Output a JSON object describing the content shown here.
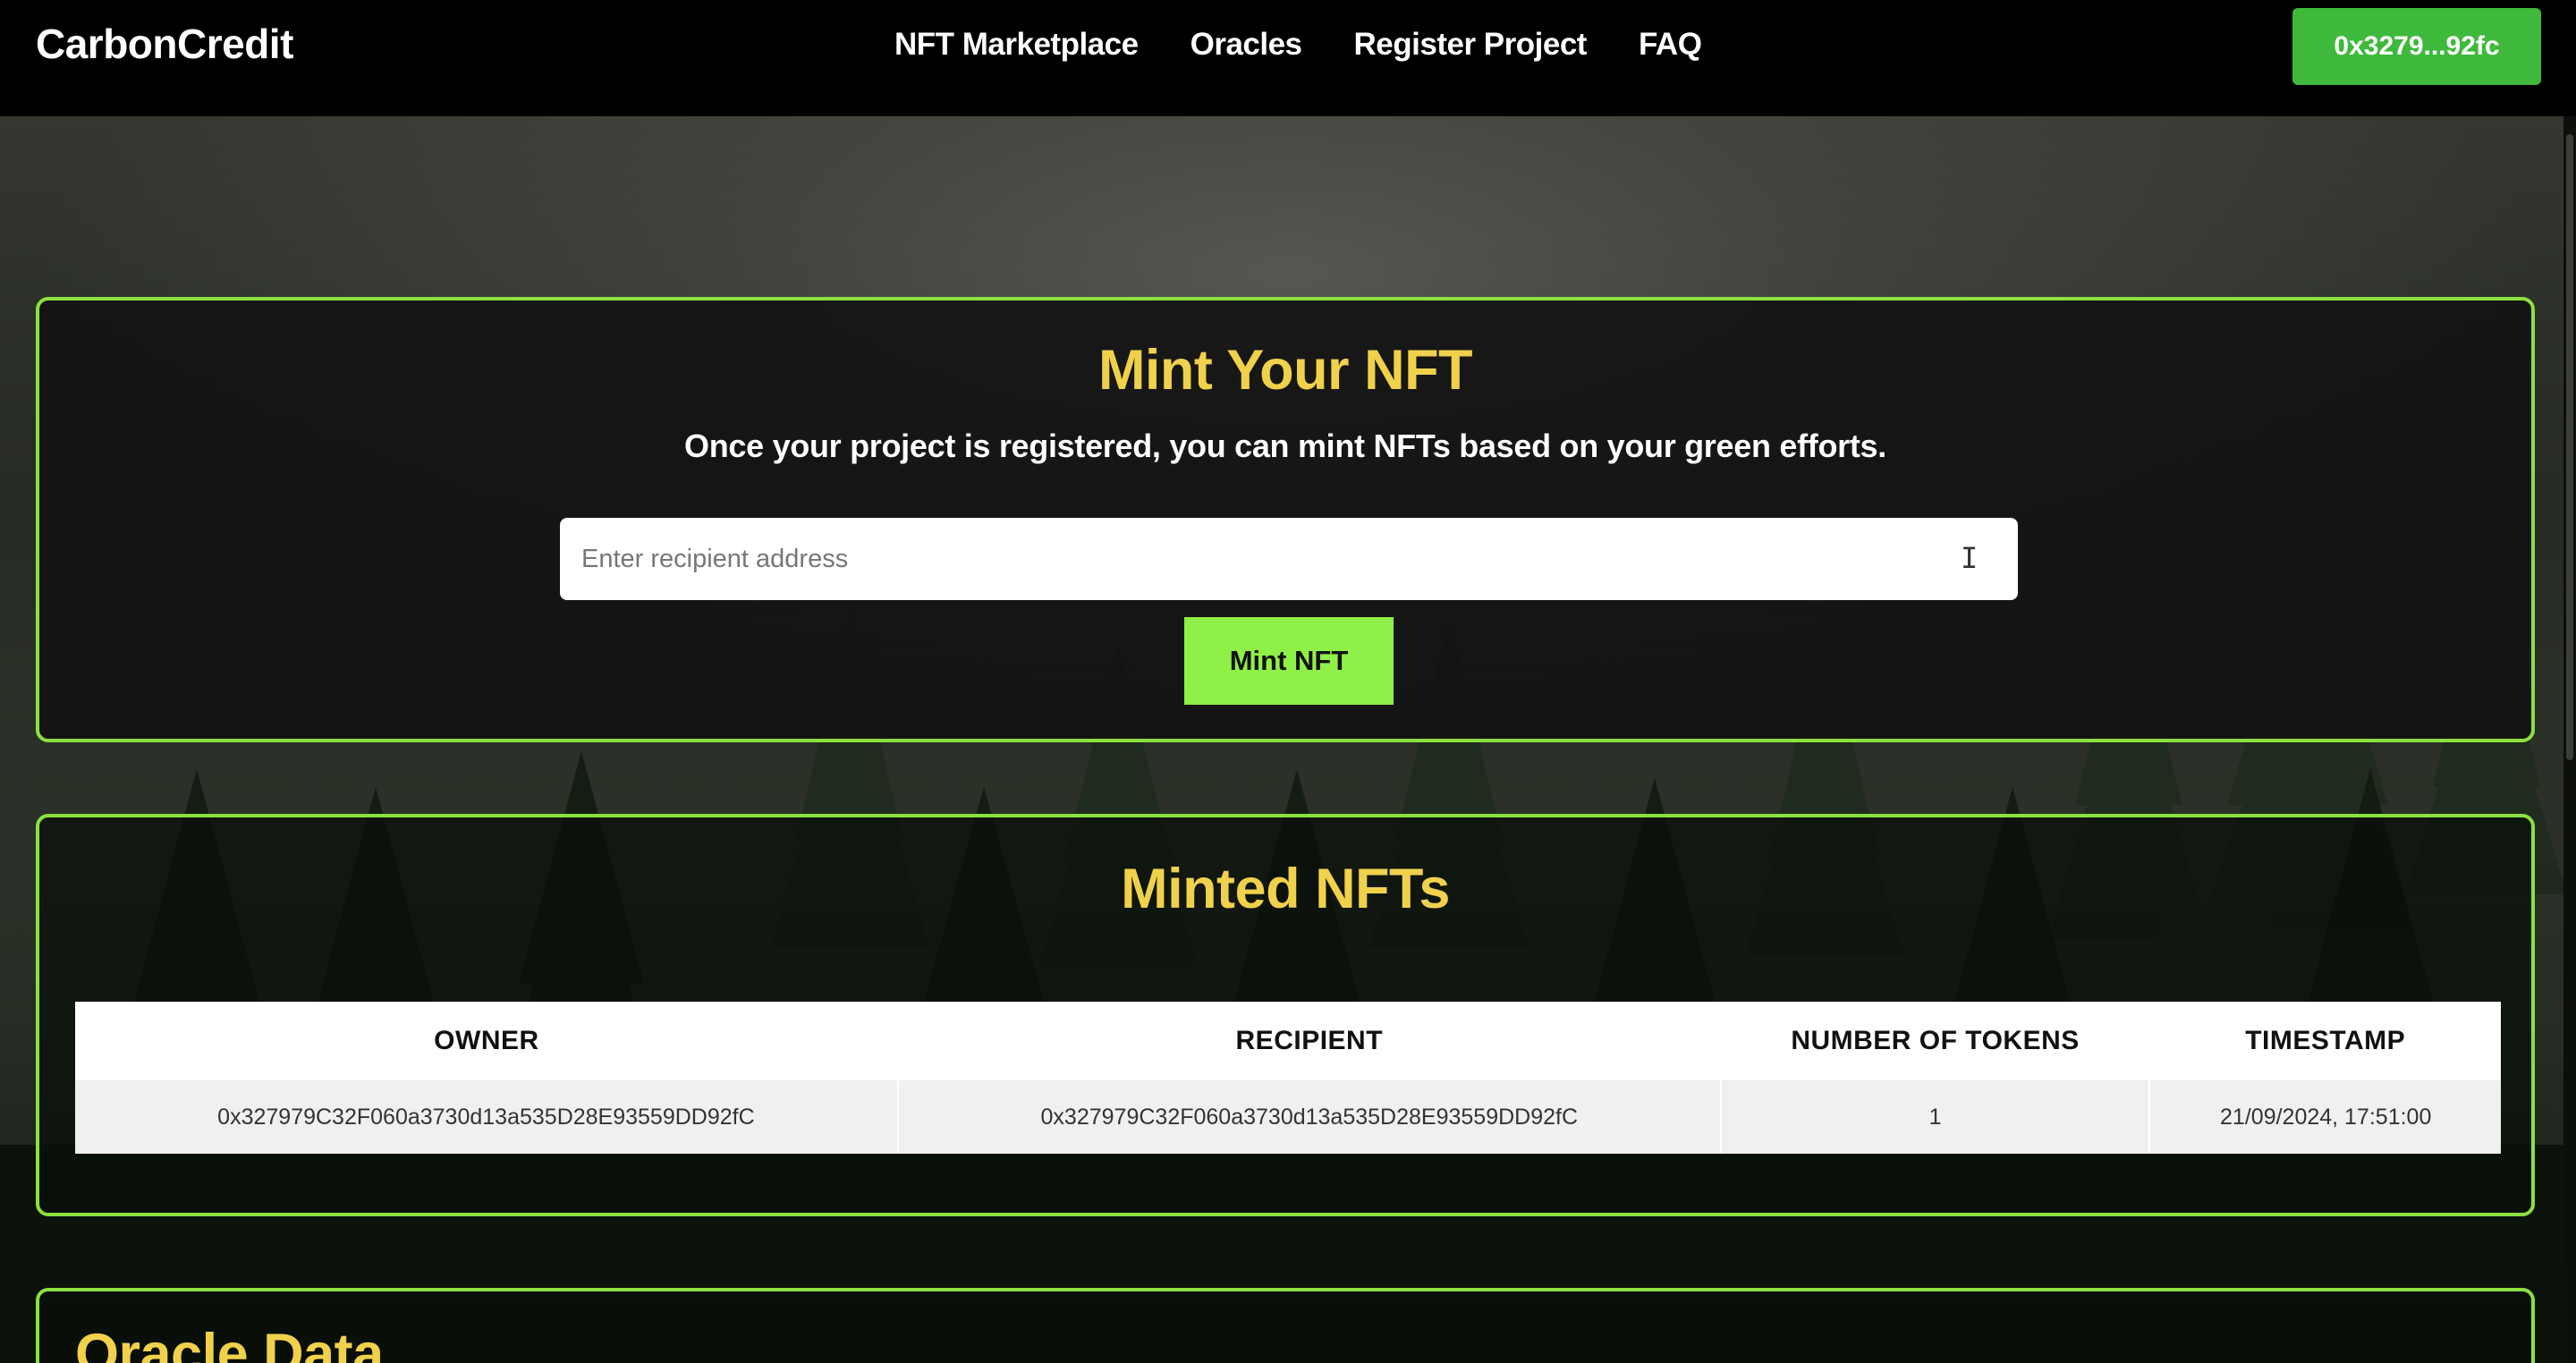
{
  "header": {
    "brand": "CarbonCredit",
    "nav": [
      "NFT Marketplace",
      "Oracles",
      "Register Project",
      "FAQ"
    ],
    "wallet_label": "0x3279...92fc"
  },
  "mint_section": {
    "title": "Mint Your NFT",
    "subtitle": "Once your project is registered, you can mint NFTs based on your green efforts.",
    "input_placeholder": "Enter recipient address",
    "input_value": "",
    "button_label": "Mint NFT"
  },
  "minted_section": {
    "title": "Minted NFTs",
    "columns": [
      "OWNER",
      "RECIPIENT",
      "NUMBER OF TOKENS",
      "TIMESTAMP"
    ],
    "rows": [
      [
        "0x327979C32F060a3730d13a535D28E93559DD92fC",
        "0x327979C32F060a3730d13a535D28E93559DD92fC",
        "1",
        "21/09/2024, 17:51:00"
      ]
    ]
  },
  "oracle_section": {
    "title": "Oracle Data"
  },
  "colors": {
    "accent_green": "#8ce040",
    "title_yellow": "#f0d14c",
    "wallet_green": "#3fb93c"
  }
}
